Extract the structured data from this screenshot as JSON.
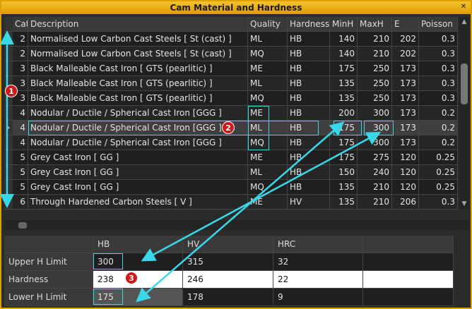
{
  "window": {
    "title": "Cam Material and Hardness"
  },
  "grid": {
    "columns": [
      "Cat",
      "Description",
      "Quality",
      "Hardness",
      "MinH",
      "MaxH",
      "E",
      "Poisson"
    ],
    "rows": [
      [
        "2",
        " Normalised Low Carbon Cast Steels [ St (cast) ]",
        "ML",
        "HB",
        "140",
        "210",
        "202",
        "0.3"
      ],
      [
        "2",
        " Normalised Low Carbon Cast Steels [ St (cast) ]",
        "MQ",
        "HB",
        "140",
        "210",
        "202",
        "0.3"
      ],
      [
        "3",
        "Black Malleable Cast Iron [ GTS (pearlitic) ]",
        "ME",
        "HB",
        "175",
        "250",
        "173",
        "0.3"
      ],
      [
        "3",
        "Black Malleable Cast Iron [ GTS (pearlitic) ]",
        "ML",
        "HB",
        "135",
        "250",
        "173",
        "0.3"
      ],
      [
        "3",
        "Black Malleable Cast Iron [ GTS (pearlitic) ]",
        "MQ",
        "HB",
        "135",
        "250",
        "173",
        "0.3"
      ],
      [
        "4",
        "Nodular / Ductile / Spherical Cast Iron [GGG ]",
        "ME",
        "HB",
        "200",
        "300",
        "173",
        "0.2"
      ],
      [
        "4",
        "Nodular / Ductile / Spherical Cast Iron [GGG ]",
        "ML",
        "HB",
        "175",
        "300",
        "173",
        "0.2"
      ],
      [
        "4",
        "Nodular / Ductile / Spherical Cast Iron [GGG ]",
        "MQ",
        "HB",
        "175",
        "300",
        "173",
        "0.2"
      ],
      [
        "5",
        "Grey Cast Iron [ GG ]",
        "ME",
        "HB",
        "175",
        "275",
        "120",
        "0.25"
      ],
      [
        "5",
        "Grey Cast Iron [ GG ]",
        "ML",
        "HB",
        "150",
        "240",
        "120",
        "0.25"
      ],
      [
        "5",
        "Grey Cast Iron [ GG ]",
        "MQ",
        "HB",
        "135",
        "210",
        "120",
        "0.25"
      ],
      [
        "6",
        "Through Hardened Carbon Steels [ V ]",
        "ME",
        "HV",
        "135",
        "210",
        "206",
        "0.3"
      ]
    ],
    "selected_row": 6
  },
  "hardness_table": {
    "columns": [
      "",
      "HB",
      "HV",
      "HRC",
      ""
    ],
    "rows": [
      {
        "label": "Upper H Limit",
        "values": [
          "300",
          "315",
          "32",
          ""
        ]
      },
      {
        "label": "Hardness",
        "values": [
          "238",
          "246",
          "22",
          ""
        ]
      },
      {
        "label": "Lower H Limit",
        "values": [
          "175",
          "178",
          "9",
          ""
        ]
      }
    ]
  },
  "annotations": {
    "badge1": "1",
    "badge2": "2",
    "badge3": "3"
  },
  "colors": {
    "title_bar": "#f0b400",
    "highlight": "#38d8e8",
    "badge": "#d01818"
  }
}
